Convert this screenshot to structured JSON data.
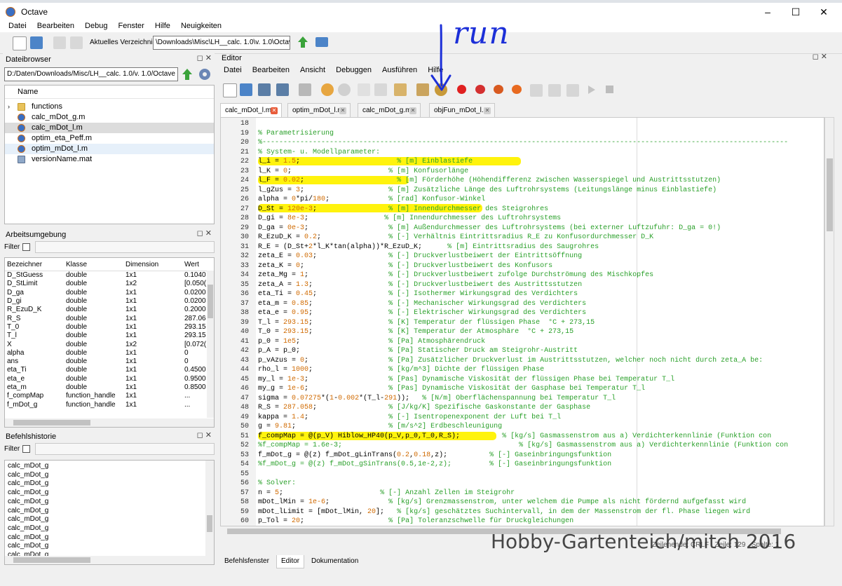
{
  "window": {
    "title": "Octave"
  },
  "main_menu": [
    "Datei",
    "Bearbeiten",
    "Debug",
    "Fenster",
    "Hilfe",
    "Neuigkeiten"
  ],
  "toolbar": {
    "cwd_label": "Aktuelles Verzeichnis:",
    "cwd_value": "\\Downloads\\Misc\\LH__calc. 1.0\\v. 1.0\\Octave"
  },
  "file_browser": {
    "title": "Dateibrowser",
    "path": "D:/Daten/Downloads/Misc/LH__calc. 1.0/v. 1.0/Octave",
    "column_header": "Name",
    "items": [
      {
        "name": "functions",
        "type": "folder"
      },
      {
        "name": "calc_mDot_g.m",
        "type": "m"
      },
      {
        "name": "calc_mDot_l.m",
        "type": "m"
      },
      {
        "name": "optim_eta_Peff.m",
        "type": "m"
      },
      {
        "name": "optim_mDot_l.m",
        "type": "m"
      },
      {
        "name": "versionName.mat",
        "type": "mat"
      }
    ]
  },
  "workspace": {
    "title": "Arbeitsumgebung",
    "filter_label": "Filter",
    "headers": [
      "Bezeichner",
      "Klasse",
      "Dimension",
      "Wert"
    ],
    "rows": [
      [
        "D_StGuess",
        "double",
        "1x1",
        "0.1040"
      ],
      [
        "D_StLimit",
        "double",
        "1x2",
        "[0.050("
      ],
      [
        "D_ga",
        "double",
        "1x1",
        "0.0200"
      ],
      [
        "D_gi",
        "double",
        "1x1",
        "0.0200"
      ],
      [
        "R_EzuD_K",
        "double",
        "1x1",
        "0.2000"
      ],
      [
        "R_S",
        "double",
        "1x1",
        "287.06"
      ],
      [
        "T_0",
        "double",
        "1x1",
        "293.15"
      ],
      [
        "T_l",
        "double",
        "1x1",
        "293.15"
      ],
      [
        "X",
        "double",
        "1x2",
        "[0.072("
      ],
      [
        "alpha",
        "double",
        "1x1",
        "0"
      ],
      [
        "ans",
        "double",
        "1x1",
        "0"
      ],
      [
        "eta_Ti",
        "double",
        "1x1",
        "0.4500"
      ],
      [
        "eta_e",
        "double",
        "1x1",
        "0.9500"
      ],
      [
        "eta_m",
        "double",
        "1x1",
        "0.8500"
      ],
      [
        "f_compMap",
        "function_handle",
        "1x1",
        "..."
      ],
      [
        "f_mDot_g",
        "function_handle",
        "1x1",
        "..."
      ]
    ]
  },
  "history": {
    "title": "Befehlshistorie",
    "filter_label": "Filter",
    "items": [
      "calc_mDot_g",
      "calc_mDot_g",
      "calc_mDot_g",
      "calc_mDot_g",
      "calc_mDot_g",
      "calc_mDot_g",
      "calc_mDot_g",
      "calc_mDot_g",
      "calc_mDot_g",
      "calc_mDot_g",
      "calc_mDot_g",
      "calc_mDot_g",
      "calc_mDot_g"
    ]
  },
  "editor": {
    "title": "Editor",
    "menu": [
      "Datei",
      "Bearbeiten",
      "Ansicht",
      "Debuggen",
      "Ausführen",
      "Hilfe"
    ],
    "tabs": [
      "calc_mDot_l.m",
      "optim_mDot_l.m",
      "calc_mDot_g.m",
      "objFun_mDot_l.m"
    ],
    "status": {
      "eol": "Zeilenende: CRLF",
      "line": "Zeile: 129",
      "col": "Spalte: 1"
    },
    "lines": [
      {
        "n": "18",
        "t": ""
      },
      {
        "n": "19",
        "t": "% Parametrisierung"
      },
      {
        "n": "20",
        "t": "%-----------------------------------------------------------------------------------------------------------------------------"
      },
      {
        "n": "21",
        "t": "% System- u. Modellparameter:"
      },
      {
        "n": "22",
        "t": "l_i = 1.5;                       % [m] Einblastiefe"
      },
      {
        "n": "23",
        "t": "l_K = 0;                       % [m] Konfusorlänge"
      },
      {
        "n": "24",
        "t": "l_F = 0.02;                      % [m] Förderhöhe (Höhendifferenz zwischen Wasserspiegel und Austrittsstutzen)"
      },
      {
        "n": "25",
        "t": "l_gZus = 3;                    % [m] Zusätzliche Länge des Luftrohrsystems (Leitungslänge minus Einblastiefe)"
      },
      {
        "n": "26",
        "t": "alpha = 0*pi/180;              % [rad] Konfusor-Winkel"
      },
      {
        "n": "27",
        "t": "D_St = 120e-3;                 % [m] Innendurchmesser des Steigrohres"
      },
      {
        "n": "28",
        "t": "D_gi = 8e-3;                  % [m] Innendurchmesser des Luftrohrsystems"
      },
      {
        "n": "29",
        "t": "D_ga = 0e-3;                   % [m] Außendurchmesser des Luftrohrsystems (bei externer Luftzufuhr: D_ga = 0!)"
      },
      {
        "n": "30",
        "t": "R_EzuD_K = 0.2;                % [-] Verhältnis Eintrittsradius R_E zu Konfusordurchmesser D_K"
      },
      {
        "n": "31",
        "t": "R_E = (D_St+2*l_K*tan(alpha))*R_EzuD_K;      % [m] Eintrittsradius des Saugrohres"
      },
      {
        "n": "32",
        "t": "zeta_E = 0.03;                 % [-] Druckverlustbeiwert der Eintrittsöffnung"
      },
      {
        "n": "33",
        "t": "zeta_K = 0;                    % [-] Druckverlustbeiwert des Konfusors"
      },
      {
        "n": "34",
        "t": "zeta_Mg = 1;                   % [-] Druckverlustbeiwert zufolge Durchströmung des Mischkopfes"
      },
      {
        "n": "35",
        "t": "zeta_A = 1.3;                  % [-] Druckverlustbeiwert des Austrittsstutzen"
      },
      {
        "n": "36",
        "t": "eta_Ti = 0.45;                 % [-] Isothermer Wirkungsgrad des Verdichters"
      },
      {
        "n": "37",
        "t": "eta_m = 0.85;                  % [-] Mechanischer Wirkungsgrad des Verdichters"
      },
      {
        "n": "38",
        "t": "eta_e = 0.95;                  % [-] Elektrischer Wirkungsgrad des Verdichters"
      },
      {
        "n": "39",
        "t": "T_l = 293.15;                  % [K] Temperatur der flüssigen Phase  °C + 273,15"
      },
      {
        "n": "40",
        "t": "T_0 = 293.15;                  % [K] Temperatur der Atmosphäre  °C + 273,15"
      },
      {
        "n": "41",
        "t": "p_0 = 1e5;                     % [Pa] Atmosphärendruck"
      },
      {
        "n": "42",
        "t": "p_A = p_0;                     % [Pa] Statischer Druck am Steigrohr-Austritt"
      },
      {
        "n": "43",
        "t": "p_vAzus = 0;                   % [Pa] Zusätzlicher Druckverlust im Austrittsstutzen, welcher noch nicht durch zeta_A be:"
      },
      {
        "n": "44",
        "t": "rho_l = 1000;                  % [kg/m^3] Dichte der flüssigen Phase"
      },
      {
        "n": "45",
        "t": "my_l = 1e-3;                   % [Pas] Dynamische Viskosität der flüssigen Phase bei Temperatur T_l"
      },
      {
        "n": "46",
        "t": "my_g = 1e-6;                   % [Pas] Dynamische Viskosität der Gasphase bei Temperatur T_l"
      },
      {
        "n": "47",
        "t": "sigma = 0.07275*(1-0.002*(T_l-291));   % [N/m] Oberflächenspannung bei Temperatur T_l"
      },
      {
        "n": "48",
        "t": "R_S = 287.058;                 % [J/kg/K] Spezifische Gaskonstante der Gasphase"
      },
      {
        "n": "49",
        "t": "kappa = 1.4;                   % [-] Isentropenexponent der Luft bei T_l"
      },
      {
        "n": "50",
        "t": "g = 9.81;                      % [m/s^2] Erdbeschleunigung"
      },
      {
        "n": "51",
        "t": "f_compMap = @(p_V) Hiblow_HP40(p_V,p_0,T_0,R_S);          % [kg/s] Gasmassenstrom aus a) Verdichterkennlinie (Funktion con"
      },
      {
        "n": "52",
        "t": "%f_compMap = 1.6e-3;                                          % [kg/s] Gasmassenstrom aus a) Verdichterkennlinie (Funktion con"
      },
      {
        "n": "53",
        "t": "f_mDot_g = @(z) f_mDot_gLinTrans(0.2,0.18,z);          % [-] Gaseinbringungsfunktion"
      },
      {
        "n": "54",
        "t": "%f_mDot_g = @(z) f_mDot_gSinTrans(0.5,1e-2,z);         % [-] Gaseinbringungsfunktion"
      },
      {
        "n": "55",
        "t": ""
      },
      {
        "n": "56",
        "t": "% Solver:"
      },
      {
        "n": "57",
        "t": "n = 5;                       % [-] Anzahl Zellen im Steigrohr"
      },
      {
        "n": "58",
        "t": "mDot_lMin = 1e-6;              % [kg/s] Grenzmassenstrom, unter welchem die Pumpe als nicht fördernd aufgefasst wird"
      },
      {
        "n": "59",
        "t": "mDot_lLimit = [mDot_lMin, 20];   % [kg/s] geschätztes Suchintervall, in dem der Massenstrom der fl. Phase liegen wird"
      },
      {
        "n": "60",
        "t": "p_Tol = 20;                    % [Pa] Toleranzschwelle für Druckgleichungen"
      }
    ]
  },
  "bottom_tabs": [
    "Befehlsfenster",
    "Editor",
    "Dokumentation"
  ],
  "annotation": {
    "handwritten": "run",
    "watermark": "Hobby-Gartenteich/mitch 2016"
  }
}
